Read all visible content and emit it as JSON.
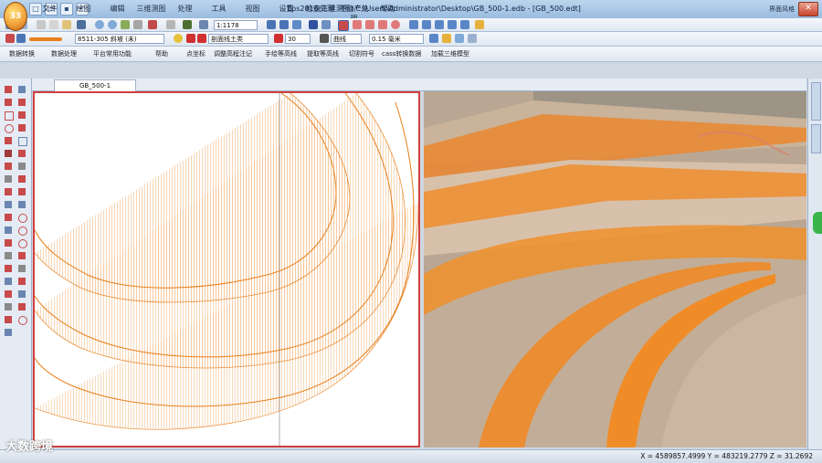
{
  "app": {
    "badge": "33",
    "window_title": "Eps2016(三维测图)    C:\\Users\\Administrator\\Desktop\\GB_500-1.edb - [GB_500.edt]",
    "user_label": "界面风格"
  },
  "menu": [
    "文件",
    "绘图",
    "编辑",
    "三维测图",
    "处理",
    "工具",
    "视图",
    "设置",
    "检查处理",
    "不动产处理",
    "帮助"
  ],
  "toolbar1": {
    "scale": "1:1178"
  },
  "toolbar2": {
    "code": "8511-305 斜坡 (未)",
    "layer": "剖面线土类",
    "width": "30",
    "line_type": "曲线",
    "line_width": "0.15 毫米"
  },
  "toolbar3": [
    "数据转换",
    "数据处理",
    "平台常用功能",
    "帮助",
    "点坐标",
    "调整高程注记",
    "手绘等高线",
    "提取等高线",
    "切割符号",
    "cass转换数据",
    "加载三维模型"
  ],
  "tabs": [
    {
      "label": "GB_500-1"
    }
  ],
  "status": {
    "coords": "X = 4589857.4999  Y = 483219.2779  Z = 31.2692"
  },
  "watermark": "大数跨境",
  "icons": {
    "orange_line": "#e87f1a",
    "frame_red": "#d04040"
  }
}
